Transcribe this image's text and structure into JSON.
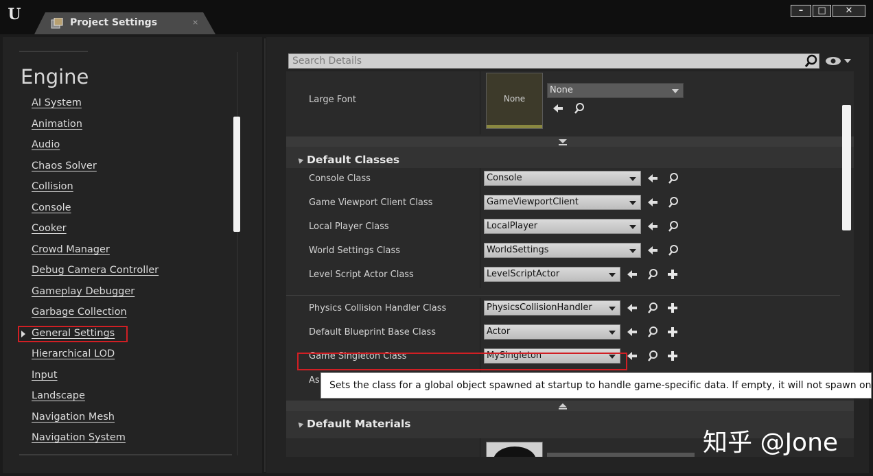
{
  "window": {
    "tab_title": "Project Settings",
    "tab_close": "×",
    "minimize": "–",
    "maximize": "□",
    "close": "✕"
  },
  "sidebar": {
    "heading": "Engine",
    "items": [
      {
        "label": "AI System"
      },
      {
        "label": "Animation"
      },
      {
        "label": "Audio"
      },
      {
        "label": "Chaos Solver"
      },
      {
        "label": "Collision"
      },
      {
        "label": "Console"
      },
      {
        "label": "Cooker"
      },
      {
        "label": "Crowd Manager"
      },
      {
        "label": "Debug Camera Controller"
      },
      {
        "label": "Gameplay Debugger"
      },
      {
        "label": "Garbage Collection"
      },
      {
        "label": "General Settings"
      },
      {
        "label": "Hierarchical LOD"
      },
      {
        "label": "Input"
      },
      {
        "label": "Landscape"
      },
      {
        "label": "Navigation Mesh"
      },
      {
        "label": "Navigation System"
      }
    ],
    "selected": "General Settings"
  },
  "search": {
    "placeholder": "Search Details"
  },
  "details": {
    "large_font": {
      "label": "Large Font",
      "thumbnail": "None",
      "value": "None"
    },
    "default_classes": {
      "title": "Default Classes",
      "rows": [
        {
          "label": "Console Class",
          "value": "Console"
        },
        {
          "label": "Game Viewport Client Class",
          "value": "GameViewportClient"
        },
        {
          "label": "Local Player Class",
          "value": "LocalPlayer"
        },
        {
          "label": "World Settings Class",
          "value": "WorldSettings"
        },
        {
          "label": "Level Script Actor Class",
          "value": "LevelScriptActor"
        },
        {
          "label": "Physics Collision Handler Class",
          "value": "PhysicsCollisionHandler"
        },
        {
          "label": "Default Blueprint Base Class",
          "value": "Actor"
        },
        {
          "label": "Game Singleton Class",
          "value": "MySingleton"
        },
        {
          "label": "As"
        }
      ]
    },
    "default_materials": {
      "title": "Default Materials"
    }
  },
  "tooltip": {
    "text": "Sets the class for a global object spawned at startup to handle game-specific data. If empty, it will not spawn one"
  },
  "watermark": {
    "text": "知乎 @Jone"
  },
  "colors": {
    "highlight_red": "#d11f24",
    "panel_bg": "#232323",
    "row_bg": "#2a2a2a"
  }
}
